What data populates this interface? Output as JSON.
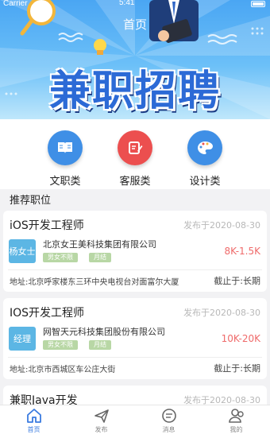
{
  "status_bar": {
    "carrier": "Carrier",
    "time": "5:41"
  },
  "header": {
    "title": "首页"
  },
  "banner": {
    "title": "兼职招聘"
  },
  "categories": [
    {
      "label": "文职类",
      "icon": "book-icon",
      "color": "#3f8fe6"
    },
    {
      "label": "客服类",
      "icon": "edit-icon",
      "color": "#ec4f4f"
    },
    {
      "label": "设计类",
      "icon": "palette-icon",
      "color": "#3f8fe6"
    }
  ],
  "section": {
    "title": "推荐职位"
  },
  "jobs": [
    {
      "title": "iOS开发工程师",
      "date": "发布于2020-08-30",
      "logo_text": "杨女士",
      "logo_color": "#5cb6e4",
      "company": "北京女王美科技集团有限公司",
      "tags": [
        "男女不限",
        "月结"
      ],
      "salary": "8K-1.5K",
      "address": "地址:北京呼家楼东三环中央电视台对面富尔大厦",
      "deadline": "截止于:长期"
    },
    {
      "title": "IOS开发工程师",
      "date": "发布于2020-08-30",
      "logo_text": "经理",
      "logo_color": "#5cb6e4",
      "company": "网智天元科技集团股份有限公司",
      "tags": [
        "男女不限",
        "月结"
      ],
      "salary": "10K-20K",
      "address": "地址:北京市西城区车公庄大街",
      "deadline": "截止于:长期"
    },
    {
      "title": "兼职Java开发",
      "date": "发布于2020-08-30"
    }
  ],
  "tabbar": [
    {
      "label": "首页",
      "icon": "home-icon",
      "active": true
    },
    {
      "label": "发布",
      "icon": "send-icon",
      "active": false
    },
    {
      "label": "消息",
      "icon": "message-icon",
      "active": false
    },
    {
      "label": "我的",
      "icon": "user-icon",
      "active": false
    }
  ],
  "colors": {
    "accent": "#3a7be0",
    "salary": "#ef6a6a",
    "tag": "#b8d7a5"
  }
}
